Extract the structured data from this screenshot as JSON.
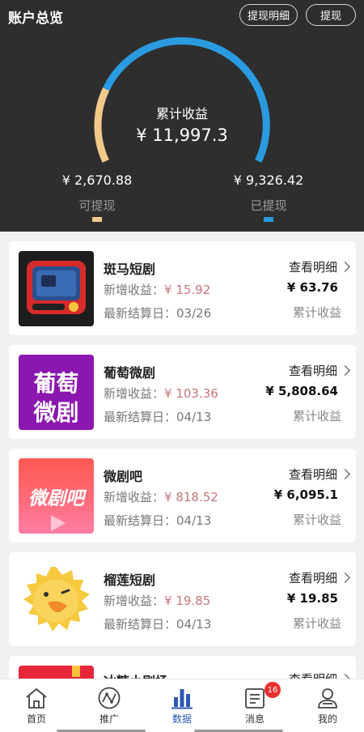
{
  "header": {
    "title": "账户总览",
    "btn_detail": "提现明细",
    "btn_withdraw": "提现",
    "center_label": "累计收益",
    "center_value": "¥ 11,997.3",
    "left_value": "¥ 2,670.88",
    "left_label": "可提现",
    "right_value": "¥ 9,326.42",
    "right_label": "已提现",
    "gauge_withdrawable_fraction": 0.22,
    "colors": {
      "withdrawable": "#f3c98a",
      "withdrawn": "#2a9be0"
    }
  },
  "cards": [
    {
      "name": "斑马短剧",
      "inc_label": "新增收益：",
      "inc": "¥ 15.92",
      "date_label": "最新结算日：",
      "date": "03/26",
      "link": "查看明细",
      "total": "¥ 63.76",
      "total_label": "累计收益",
      "icon": "zebra-tv-icon"
    },
    {
      "name": "葡萄微剧",
      "inc_label": "新增收益：",
      "inc": "¥ 103.36",
      "date_label": "最新结算日：",
      "date": "04/13",
      "link": "查看明细",
      "total": "¥ 5,808.64",
      "total_label": "累计收益",
      "icon": "grape-drama-logo",
      "logo_line1": "葡萄",
      "logo_line2": "微剧"
    },
    {
      "name": "微剧吧",
      "inc_label": "新增收益：",
      "inc": "¥ 818.52",
      "date_label": "最新结算日：",
      "date": "04/13",
      "link": "查看明细",
      "total": "¥ 6,095.1",
      "total_label": "累计收益",
      "icon": "weiju-ba-logo",
      "logo_text": "微剧吧"
    },
    {
      "name": "榴莲短剧",
      "inc_label": "新增收益：",
      "inc": "¥ 19.85",
      "date_label": "最新结算日：",
      "date": "04/13",
      "link": "查看明细",
      "total": "¥ 19.85",
      "total_label": "累计收益",
      "icon": "durian-duck-icon"
    },
    {
      "name": "冰糖小剧场",
      "link": "查看明细",
      "icon": "sugar-theater-icon"
    }
  ],
  "tabs": [
    {
      "label": "首页",
      "icon": "home-icon"
    },
    {
      "label": "推广",
      "icon": "promote-icon"
    },
    {
      "label": "数据",
      "icon": "bar-chart-icon",
      "active": true
    },
    {
      "label": "消息",
      "icon": "message-icon",
      "badge": "16"
    },
    {
      "label": "我的",
      "icon": "profile-icon"
    }
  ]
}
